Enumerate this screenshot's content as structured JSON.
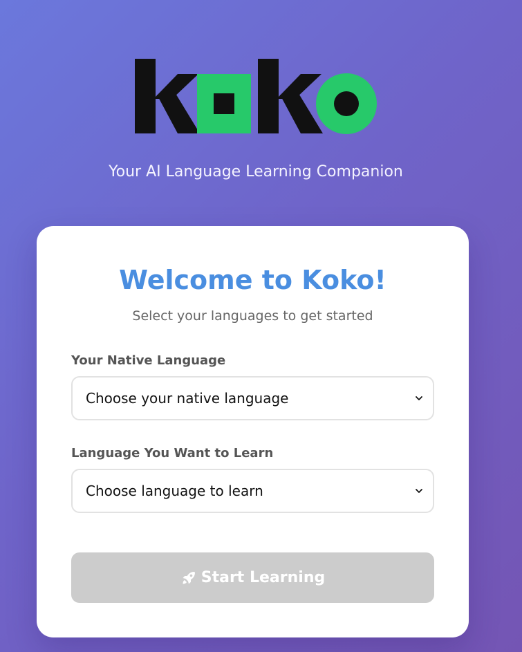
{
  "brand": {
    "logo_text": "koko",
    "tagline": "Your AI Language Learning Companion"
  },
  "card": {
    "title": "Welcome to Koko!",
    "subtitle": "Select your languages to get started"
  },
  "native_language": {
    "label": "Your Native Language",
    "selected": "Choose your native language"
  },
  "target_language": {
    "label": "Language You Want to Learn",
    "selected": "Choose language to learn"
  },
  "start_button": {
    "icon": "rocket-icon",
    "label": "Start Learning",
    "disabled": true
  },
  "colors": {
    "title_blue": "#4a8ee0",
    "logo_green": "#27c96a",
    "logo_black": "#111111",
    "button_disabled": "#cccccc"
  }
}
